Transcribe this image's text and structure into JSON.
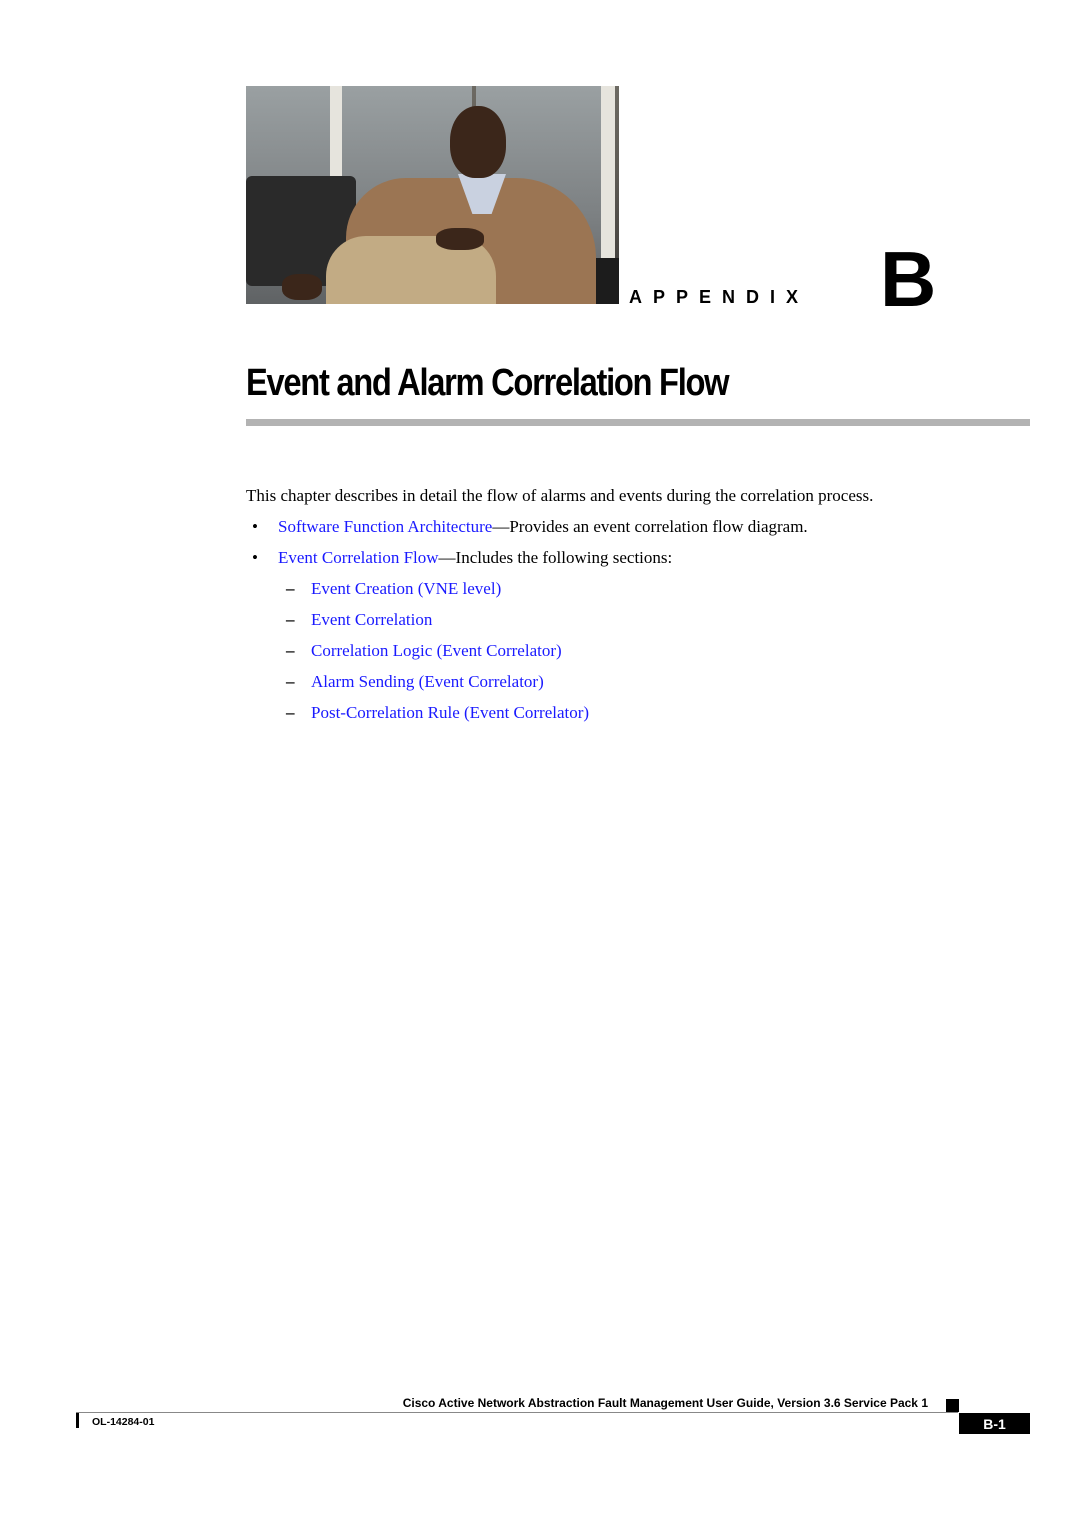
{
  "header": {
    "photo_alt": "Man in tan jacket seated in a leather chair",
    "appendix_word": "APPENDIX",
    "appendix_letter": "B"
  },
  "page_title": "Event and Alarm Correlation Flow",
  "intro": "This chapter describes in detail the flow of alarms and events during the correlation process.",
  "bullets": [
    {
      "link": "Software Function Architecture",
      "text": "—Provides an event correlation flow diagram."
    },
    {
      "link": "Event Correlation Flow",
      "text": "—Includes the following sections:"
    }
  ],
  "subsections": [
    "Event Creation (VNE level)",
    "Event Correlation",
    "Correlation Logic (Event Correlator)",
    "Alarm Sending (Event Correlator)",
    "Post-Correlation Rule (Event Correlator)"
  ],
  "symbols": {
    "bullet": "•",
    "dash": "–"
  },
  "footer": {
    "guide_title": "Cisco Active Network Abstraction Fault Management User Guide, Version 3.6 Service Pack 1",
    "doc_number": "OL-14284-01",
    "page_number": "B-1"
  },
  "colors": {
    "link": "#1a1aff",
    "rule": "#b3b3b3"
  }
}
